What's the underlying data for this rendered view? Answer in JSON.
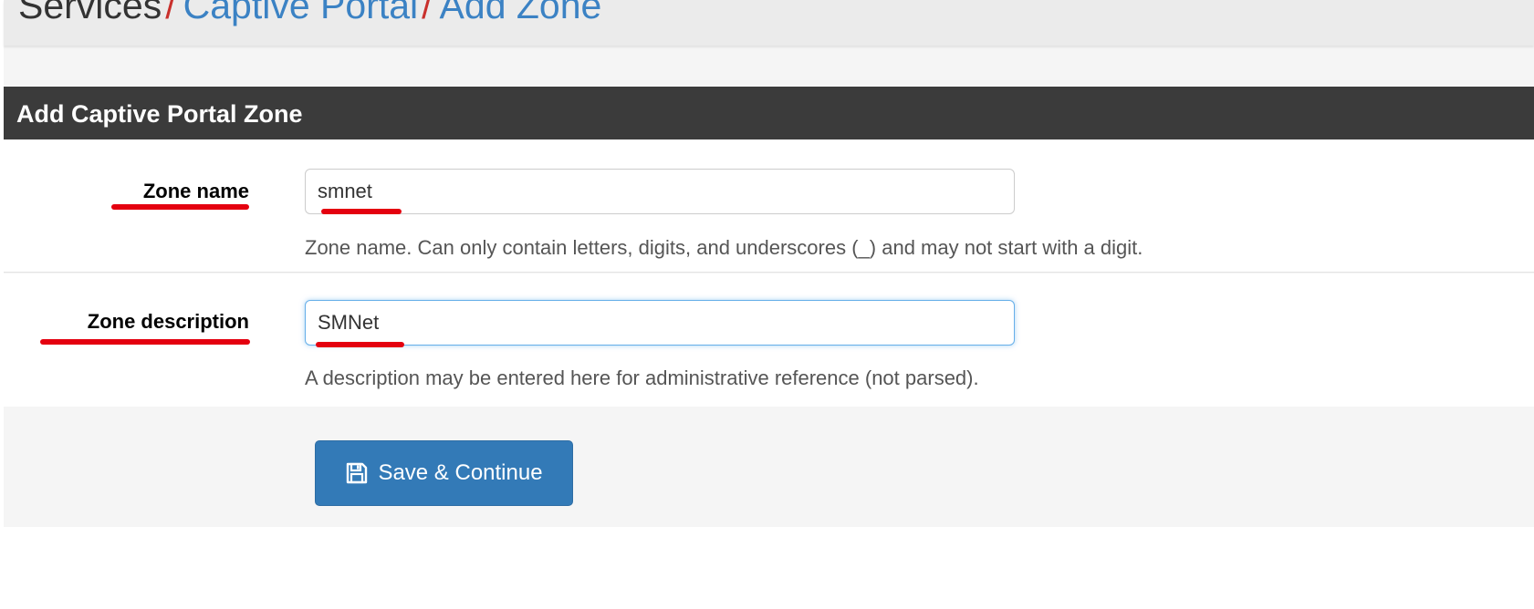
{
  "breadcrumb": {
    "items": [
      "Services",
      "Captive Portal",
      "Add Zone"
    ],
    "separator": "/"
  },
  "panel": {
    "title": "Add Captive Portal Zone"
  },
  "form": {
    "zone_name": {
      "label": "Zone name",
      "value": "smnet",
      "help": "Zone name. Can only contain letters, digits, and underscores (_) and may not start with a digit."
    },
    "zone_description": {
      "label": "Zone description",
      "value": "SMNet",
      "help": "A description may be entered here for administrative reference (not parsed)."
    }
  },
  "actions": {
    "save_label": "Save & Continue",
    "save_icon": "floppy-disk-icon"
  },
  "colors": {
    "panel_header": "#3b3b3b",
    "link": "#3b82c4",
    "separator": "#c9302c",
    "primary_button": "#337ab7",
    "annotation": "#e4000f",
    "focus_border": "#66afe9"
  }
}
